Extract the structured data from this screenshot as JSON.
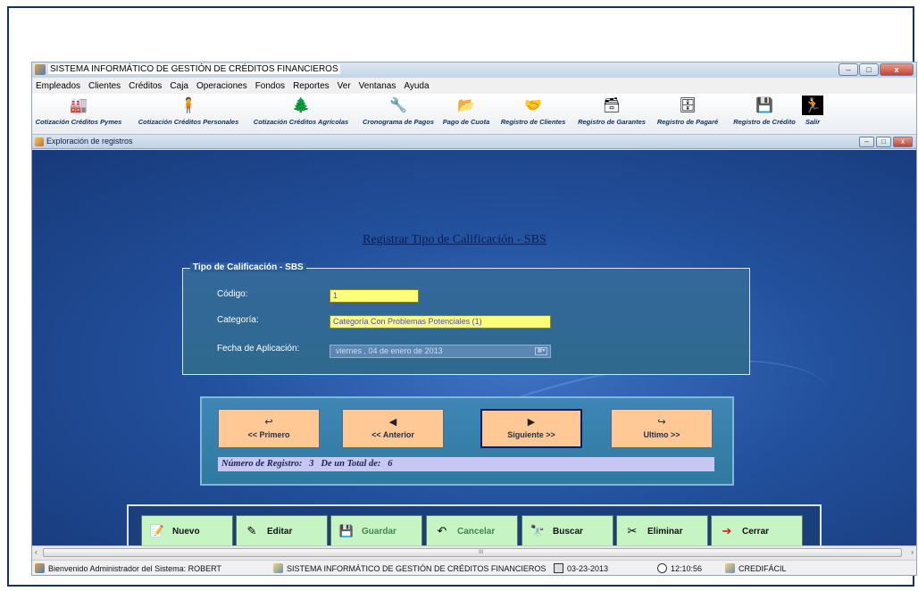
{
  "window": {
    "title": "SISTEMA INFORMÁTICO DE GESTIÓN DE CRÉDITOS FINANCIEROS",
    "minimize": "–",
    "maximize": "□",
    "close": "x"
  },
  "menu": [
    "Empleados",
    "Clientes",
    "Créditos",
    "Caja",
    "Operaciones",
    "Fondos",
    "Reportes",
    "Ver",
    "Ventanas",
    "Ayuda"
  ],
  "toolbar": [
    {
      "label": "Cotización Créditos Pymes",
      "icon": "pymes-icon",
      "glyph": "🏭"
    },
    {
      "label": "Cotización Créditos Personales",
      "icon": "personal-icon",
      "glyph": "🧍"
    },
    {
      "label": "Cotización Créditos Agrícolas",
      "icon": "tree-icon",
      "glyph": "🌲"
    },
    {
      "label": "Cronograma de Pagos",
      "icon": "schedule-icon",
      "glyph": "🔧"
    },
    {
      "label": "Pago de Cuota",
      "icon": "payment-icon",
      "glyph": "📂"
    },
    {
      "label": "Registro de Clientes",
      "icon": "clients-icon",
      "glyph": "🤝"
    },
    {
      "label": "Registro de Garantes",
      "icon": "guarantors-icon",
      "glyph": "🗃"
    },
    {
      "label": "Registro de Pagaré",
      "icon": "promissory-icon",
      "glyph": "🗄"
    },
    {
      "label": "Registro de Crédito",
      "icon": "credit-icon",
      "glyph": "💾"
    },
    {
      "label": "Salir",
      "icon": "exit-icon",
      "glyph": "🏃"
    }
  ],
  "child_window": {
    "title": "Exploración de registros",
    "minimize": "–",
    "maximize": "□",
    "close": "x"
  },
  "form": {
    "title": "Registrar Tipo de Calificación - SBS",
    "group_title": "Tipo de Calificación - SBS",
    "codigo_label": "Código:",
    "codigo_value": "1",
    "categoria_label": "Categoría:",
    "categoria_value": "Categoría Con Problemas Potenciales (1)",
    "fecha_label": "Fecha de Aplicación:",
    "fecha_value": "viernes , 04 de    enero    de 2013",
    "fecha_icon": "▦▾"
  },
  "navigation": {
    "buttons": [
      {
        "label": "<< Primero",
        "arrow": "↩"
      },
      {
        "label": "<< Anterior",
        "arrow": "◀"
      },
      {
        "label": "Siguiente >>",
        "arrow": "▶"
      },
      {
        "label": "Ultimo >>",
        "arrow": "↪"
      }
    ],
    "record_label": "Número de Registro:",
    "record_number": "3",
    "total_label": "De un Total de:",
    "total_number": "6"
  },
  "actions": [
    {
      "label": "Nuevo",
      "glyph": "📝"
    },
    {
      "label": "Editar",
      "glyph": "✎"
    },
    {
      "label": "Guardar",
      "glyph": "💾"
    },
    {
      "label": "Cancelar",
      "glyph": "↶"
    },
    {
      "label": "Buscar",
      "glyph": "🔭"
    },
    {
      "label": "Eliminar",
      "glyph": "✂"
    },
    {
      "label": "Cerrar",
      "glyph": "➔"
    }
  ],
  "scrollbar": {
    "left": "‹",
    "right": "›",
    "grip": "III"
  },
  "status": {
    "welcome": "Bienvenido Administrador del Sistema: ROBERT",
    "system": "SISTEMA INFORMÁTICO DE GESTIÓN DE CRÉDITOS FINANCIEROS",
    "date": "03-23-2013",
    "time": "12:10:56",
    "brand": "CREDIFÁCIL"
  }
}
